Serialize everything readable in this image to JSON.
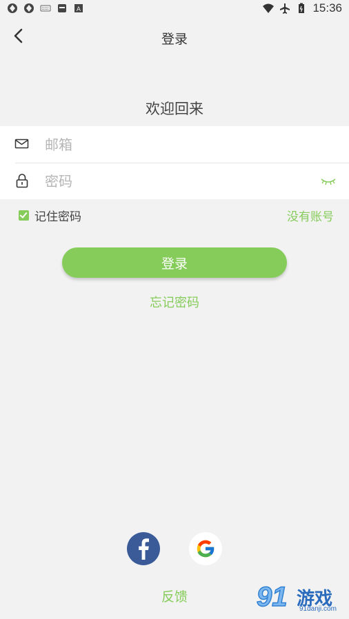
{
  "status_bar": {
    "time": "15:36",
    "icons": [
      "app-icon-1",
      "app-icon-2",
      "keyboard-icon",
      "sd-card-icon",
      "font-icon",
      "wifi-icon",
      "airplane-icon",
      "battery-icon"
    ]
  },
  "header": {
    "title": "登录"
  },
  "welcome": "欢迎回来",
  "form": {
    "email_placeholder": "邮箱",
    "password_placeholder": "密码"
  },
  "remember_me": {
    "label": "记住密码",
    "checked": true
  },
  "no_account": "没有账号",
  "login_button": "登录",
  "forgot_password": "忘记密码",
  "social": {
    "icons": [
      "facebook-icon",
      "google-icon"
    ]
  },
  "feedback": "反馈",
  "watermark": {
    "number": "91",
    "text": "游戏",
    "url": "91danji.com"
  },
  "colors": {
    "accent": "#86cc5a",
    "background": "#f2f2f2",
    "facebook": "#3a5a98"
  }
}
